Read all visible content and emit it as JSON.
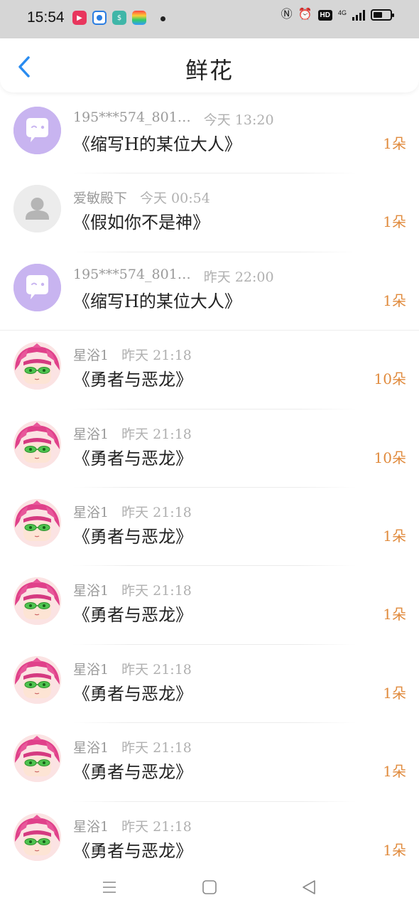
{
  "status_bar": {
    "time": "15:54",
    "app_icons": [
      "video-app-icon",
      "browser-app-icon",
      "security-app-icon",
      "wallet-app-icon"
    ],
    "battery_level_percent": 55,
    "network_label": "4G",
    "hd_label": "HD"
  },
  "header": {
    "title": "鲜花"
  },
  "items": [
    {
      "name": "195***574_801…",
      "time": "今天 13:20",
      "book": "《缩写H的某位大人》",
      "count": "1朵",
      "avatar": "purple-chat-avatar"
    },
    {
      "name": "爱敏殿下",
      "time": "今天 00:54",
      "book": "《假如你不是神》",
      "count": "1朵",
      "avatar": "default-user-avatar"
    },
    {
      "name": "195***574_801…",
      "time": "昨天 22:00",
      "book": "《缩写H的某位大人》",
      "count": "1朵",
      "avatar": "purple-chat-avatar"
    },
    {
      "name": "星浴1",
      "time": "昨天 21:18",
      "book": "《勇者与恶龙》",
      "count": "10朵",
      "avatar": "anime-avatar"
    },
    {
      "name": "星浴1",
      "time": "昨天 21:18",
      "book": "《勇者与恶龙》",
      "count": "10朵",
      "avatar": "anime-avatar"
    },
    {
      "name": "星浴1",
      "time": "昨天 21:18",
      "book": "《勇者与恶龙》",
      "count": "1朵",
      "avatar": "anime-avatar"
    },
    {
      "name": "星浴1",
      "time": "昨天 21:18",
      "book": "《勇者与恶龙》",
      "count": "1朵",
      "avatar": "anime-avatar"
    },
    {
      "name": "星浴1",
      "time": "昨天 21:18",
      "book": "《勇者与恶龙》",
      "count": "1朵",
      "avatar": "anime-avatar"
    },
    {
      "name": "星浴1",
      "time": "昨天 21:18",
      "book": "《勇者与恶龙》",
      "count": "1朵",
      "avatar": "anime-avatar"
    },
    {
      "name": "星浴1",
      "time": "昨天 21:18",
      "book": "《勇者与恶龙》",
      "count": "1朵",
      "avatar": "anime-avatar"
    }
  ],
  "nav_bar": {
    "buttons": [
      "menu-icon",
      "home-icon",
      "back-triangle-icon"
    ]
  },
  "colors": {
    "accent_blue": "#2a8cf0",
    "count_orange": "#e08a3c",
    "meta_gray": "#9a9a9a"
  }
}
